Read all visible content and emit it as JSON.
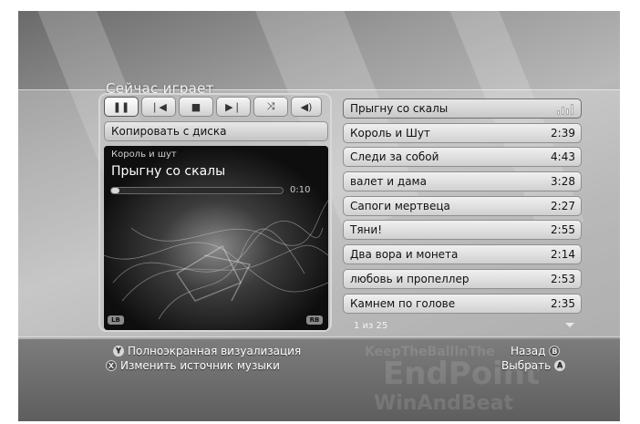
{
  "colors": {
    "frame_background": "#a2a2a2",
    "panel_border": "#d8d8d8",
    "button_face": "#e8e8e8",
    "visualizer_background": "#0e0e0e",
    "text_light": "#ffffff",
    "text_dark": "#111111"
  },
  "header": {
    "title": "Сейчас играет"
  },
  "controls": [
    {
      "name": "pause-button",
      "icon": "pause-icon",
      "glyph": "❚❚",
      "active": true
    },
    {
      "name": "previous-button",
      "icon": "previous-track-icon",
      "glyph": "❘◀",
      "active": false
    },
    {
      "name": "stop-button",
      "icon": "stop-icon",
      "glyph": "■",
      "active": false
    },
    {
      "name": "next-button",
      "icon": "next-track-icon",
      "glyph": "▶❘",
      "active": false
    },
    {
      "name": "shuffle-button",
      "icon": "shuffle-icon",
      "glyph": "⤨",
      "active": false
    },
    {
      "name": "volume-button",
      "icon": "volume-icon",
      "glyph": "◀)",
      "active": false
    }
  ],
  "copy_button": {
    "label": "Копировать с диска"
  },
  "now_playing": {
    "artist": "Король и шут",
    "track": "Прыгну со скалы",
    "elapsed": "0:10",
    "progress_fraction": 0.05
  },
  "bumpers": {
    "left": "LB",
    "right": "RB"
  },
  "playlist": {
    "tracks": [
      {
        "title": "Прыгну со скалы",
        "duration": "",
        "playing": true
      },
      {
        "title": "Король и Шут",
        "duration": "2:39",
        "playing": false
      },
      {
        "title": "Следи за собой",
        "duration": "4:43",
        "playing": false
      },
      {
        "title": "валет и дама",
        "duration": "3:28",
        "playing": false
      },
      {
        "title": "Сапоги мертвеца",
        "duration": "2:27",
        "playing": false
      },
      {
        "title": "Тяни!",
        "duration": "2:55",
        "playing": false
      },
      {
        "title": "Два вора и монета",
        "duration": "2:14",
        "playing": false
      },
      {
        "title": "любовь и пропеллер",
        "duration": "2:53",
        "playing": false
      },
      {
        "title": "Камнем по голове",
        "duration": "2:35",
        "playing": false
      }
    ],
    "page_indicator": "1 из 25"
  },
  "hints": {
    "fullscreen_visualization": {
      "button": "Y",
      "label": "Полноэкранная визуализация"
    },
    "change_source": {
      "button": "X",
      "label": "Изменить источник музыки"
    },
    "back": {
      "button": "B",
      "label": "Назад"
    },
    "select": {
      "button": "A",
      "label": "Выбрать"
    }
  },
  "background_watermark": {
    "line1": "KeepTheBallInThe",
    "line2": "EndPoint",
    "line3": "WinAndBeat"
  }
}
